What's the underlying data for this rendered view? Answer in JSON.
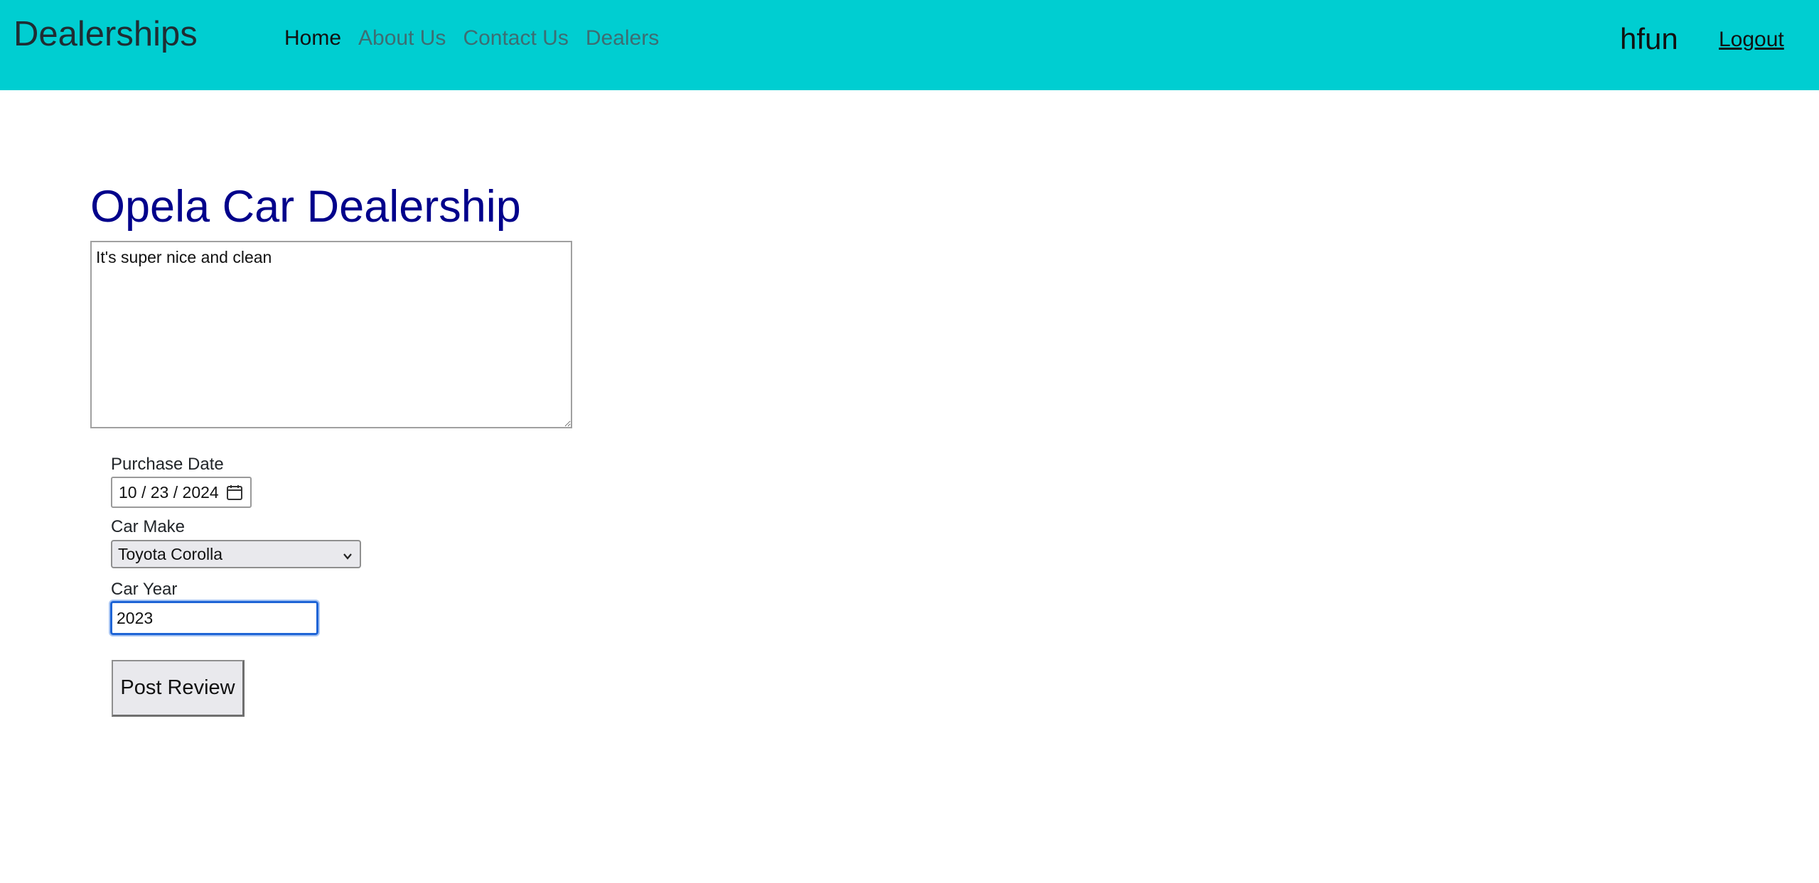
{
  "navbar": {
    "brand": "Dealerships",
    "links": [
      {
        "label": "Home",
        "active": true
      },
      {
        "label": "About Us",
        "active": false
      },
      {
        "label": "Contact Us",
        "active": false
      },
      {
        "label": "Dealers",
        "active": false
      }
    ],
    "username": "hfun",
    "logout_label": "Logout",
    "background_color": "#00ced1"
  },
  "main": {
    "title": "Opela Car Dealership",
    "title_color": "#00008b",
    "review_text": "It's super nice and clean",
    "purchase_date": {
      "label": "Purchase Date",
      "month": "10",
      "day": "23",
      "year": "2024",
      "icon": "calendar-icon"
    },
    "car_make": {
      "label": "Car Make",
      "selected": "Toyota Corolla",
      "icon": "chevron-down-icon"
    },
    "car_year": {
      "label": "Car Year",
      "value": "2023"
    },
    "post_button_label": "Post Review"
  }
}
